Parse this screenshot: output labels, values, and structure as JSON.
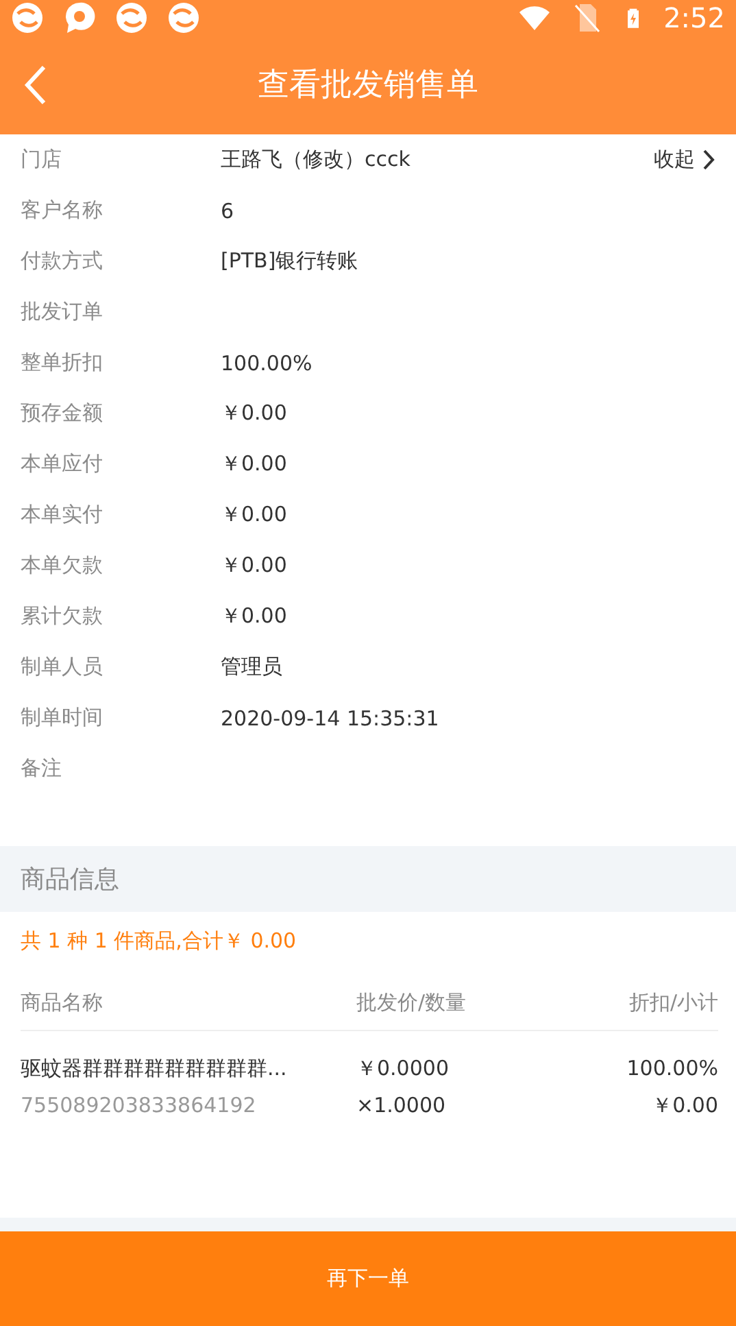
{
  "status_bar": {
    "time": "2:52"
  },
  "header": {
    "title": "查看批发销售单"
  },
  "details": {
    "collapse_label": "收起",
    "fields": [
      {
        "label": "门店",
        "value": "王路飞（修改）ccck"
      },
      {
        "label": "客户名称",
        "value": "6"
      },
      {
        "label": "付款方式",
        "value": "[PTB]银行转账"
      },
      {
        "label": "批发订单"
      },
      {
        "label": "整单折扣",
        "value": "100.00%"
      },
      {
        "label": "预存金额",
        "value": "￥0.00"
      },
      {
        "label": "本单应付",
        "value": "￥0.00"
      },
      {
        "label": "本单实付",
        "value": "￥0.00"
      },
      {
        "label": "本单欠款",
        "value": "￥0.00"
      },
      {
        "label": "累计欠款",
        "value": "￥0.00"
      },
      {
        "label": "制单人员",
        "value": "管理员"
      },
      {
        "label": "制单时间",
        "value": "2020-09-14 15:35:31"
      },
      {
        "label": "备注"
      }
    ]
  },
  "goods": {
    "section_title": "商品信息",
    "summary": "共 1 种 1 件商品,合计￥ 0.00",
    "columns": [
      "商品名称",
      "批发价/数量",
      "折扣/小计"
    ],
    "rows": [
      {
        "name": "驱蚊器群群群群群群群群群...",
        "barcode": "755089203833864192",
        "price": "￥0.0000",
        "quantity": "×1.0000",
        "discount": "100.00%",
        "subtotal": "￥0.00"
      }
    ]
  },
  "footer": {
    "button": "再下一单"
  }
}
